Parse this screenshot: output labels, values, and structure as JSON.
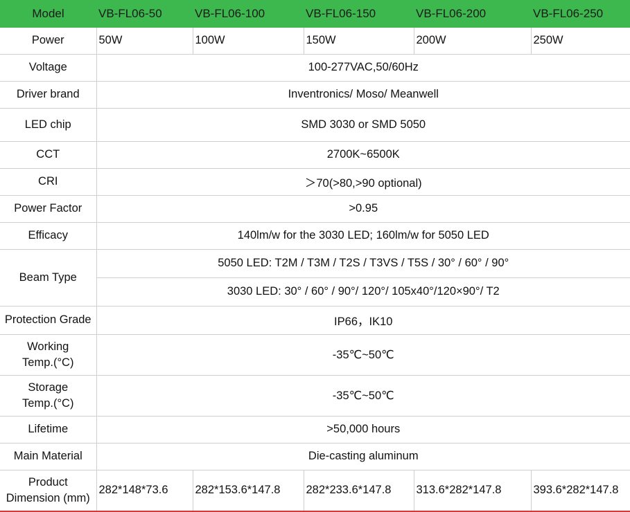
{
  "header": {
    "model_label": "Model",
    "models": [
      "VB-FL06-50",
      "VB-FL06-100",
      "VB-FL06-150",
      "VB-FL06-200",
      "VB-FL06-250"
    ]
  },
  "rows": {
    "power": {
      "label": "Power",
      "values": [
        "50W",
        "100W",
        "150W",
        "200W",
        "250W"
      ]
    },
    "voltage": {
      "label": "Voltage",
      "value": "100-277VAC,50/60Hz"
    },
    "driver": {
      "label": "Driver brand",
      "value": "Inventronics/ Moso/ Meanwell"
    },
    "chip": {
      "label": "LED chip",
      "value": "SMD 3030 or SMD 5050"
    },
    "cct": {
      "label": "CCT",
      "value": "2700K~6500K"
    },
    "cri": {
      "label": "CRI",
      "value": "＞70(>80,>90 optional)"
    },
    "pf": {
      "label": "Power Factor",
      "value": ">0.95"
    },
    "efficacy": {
      "label": "Efficacy",
      "value": "140lm/w for the 3030 LED; 160lm/w for 5050 LED"
    },
    "beam": {
      "label": "Beam Type",
      "value_1": "5050 LED: T2M / T3M / T2S / T3VS / T5S / 30° / 60° / 90°",
      "value_2": "3030 LED: 30° / 60° / 90°/ 120°/ 105x40°/120×90°/ T2"
    },
    "protection": {
      "label": "Protection Grade",
      "value": "IP66，IK10"
    },
    "working": {
      "label_1": "Working",
      "label_2": "Temp.(°C)",
      "value": "-35℃~50℃"
    },
    "storage": {
      "label_1": "Storage",
      "label_2": "Temp.(°C)",
      "value": "-35℃~50℃"
    },
    "lifetime": {
      "label": "Lifetime",
      "value": ">50,000 hours"
    },
    "material": {
      "label": "Main Material",
      "value": "Die-casting aluminum"
    },
    "dimension": {
      "label_1": "Product",
      "label_2": "Dimension (mm)",
      "values": [
        "282*148*73.6",
        "282*153.6*147.8",
        "282*233.6*147.8",
        "313.6*282*147.8",
        "393.6*282*147.8"
      ]
    }
  }
}
